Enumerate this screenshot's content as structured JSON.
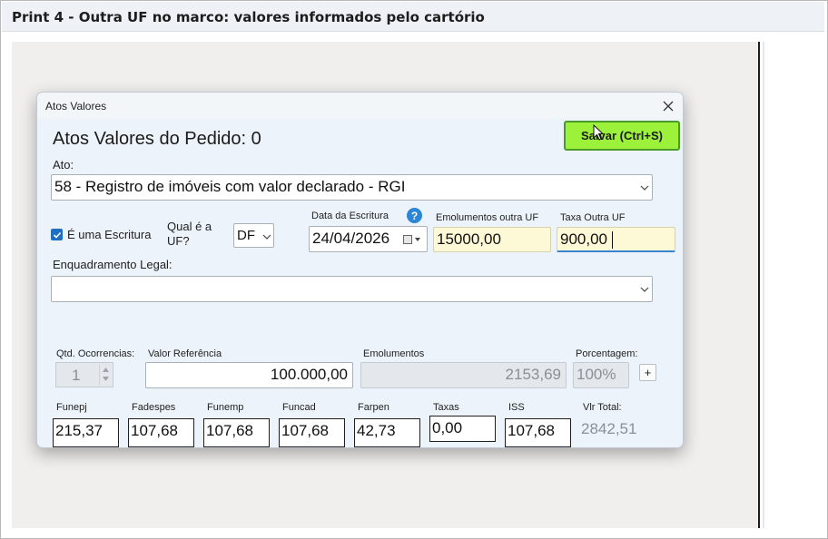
{
  "page_title": "Print 4 - Outra UF no marco: valores informados pelo cartório",
  "dialog": {
    "title": "Atos Valores",
    "heading": "Atos Valores do Pedido: 0",
    "save_label": "Salvar (Ctrl+S)",
    "ato": {
      "label": "Ato:",
      "value": "58 - Registro de imóveis com valor declarado - RGI"
    },
    "escritura": {
      "label": "É uma Escritura",
      "checked": true
    },
    "qual_uf": {
      "label_line1": "Qual é a",
      "label_line2": "UF?",
      "value": "DF"
    },
    "data_escritura": {
      "label": "Data da Escritura",
      "value": "24/04/2026",
      "help": "?"
    },
    "emolumentos_outra_uf": {
      "label": "Emolumentos outra UF",
      "value": "15000,00"
    },
    "taxa_outra_uf": {
      "label": "Taxa Outra UF",
      "value": "900,00"
    },
    "enquadramento": {
      "label": "Enquadramento Legal:",
      "value": ""
    },
    "qtd_ocorrencias": {
      "label": "Qtd. Ocorrencias:",
      "value": "1"
    },
    "valor_referencia": {
      "label": "Valor Referência",
      "value": "100.000,00"
    },
    "emolumentos": {
      "label": "Emolumentos",
      "value": "2153,69"
    },
    "porcentagem": {
      "label": "Porcentagem:",
      "value": "100%",
      "add": "+"
    },
    "fees": {
      "funepj": {
        "label": "Funepj",
        "value": "215,37"
      },
      "fadespes": {
        "label": "Fadespes",
        "value": "107,68"
      },
      "funemp": {
        "label": "Funemp",
        "value": "107,68"
      },
      "funcad": {
        "label": "Funcad",
        "value": "107,68"
      },
      "farpen": {
        "label": "Farpen",
        "value": "42,73"
      },
      "taxas": {
        "label": "Taxas",
        "value": "0,00"
      },
      "iss": {
        "label": "ISS",
        "value": "107,68"
      },
      "vlr_total": {
        "label": "Vlr Total:",
        "value": "2842,51"
      }
    }
  },
  "colors": {
    "save_button": "#9cf23a",
    "accent_blue": "#1f6fc4",
    "highlight_field": "#fdf8d6"
  }
}
